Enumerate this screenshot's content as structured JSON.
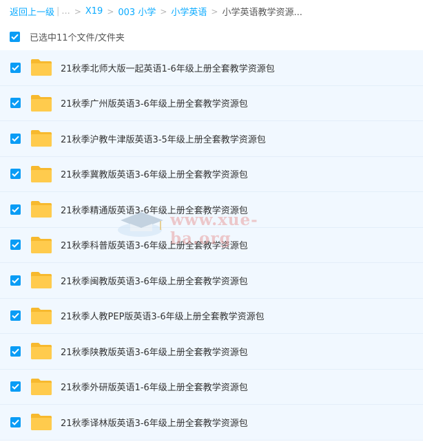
{
  "breadcrumb": {
    "back": "返回上一级",
    "ellipsis": "...",
    "items": [
      "X19",
      "003 小学",
      "小学英语"
    ],
    "current": "小学英语教学资源..."
  },
  "selection": {
    "label": "已选中11个文件/文件夹"
  },
  "files": [
    "21秋季北师大版一起英语1-6年级上册全套教学资源包",
    "21秋季广州版英语3-6年级上册全套教学资源包",
    "21秋季沪教牛津版英语3-5年级上册全套教学资源包",
    "21秋季冀教版英语3-6年级上册全套教学资源包",
    "21秋季精通版英语3-6年级上册全套教学资源包",
    "21秋季科普版英语3-6年级上册全套教学资源包",
    "21秋季闽教版英语3-6年级上册全套教学资源包",
    "21秋季人教PEP版英语3-6年级上册全套教学资源包",
    "21秋季陕教版英语3-6年级上册全套教学资源包",
    "21秋季外研版英语1-6年级上册全套教学资源包",
    "21秋季译林版英语3-6年级上册全套教学资源包"
  ],
  "watermark": {
    "text": "www.xue-ba.org"
  },
  "colors": {
    "accent": "#09aaff",
    "checkbox": "#0a9cf5",
    "row_bg": "#f1f8ff",
    "folder": "#ffc94a"
  }
}
